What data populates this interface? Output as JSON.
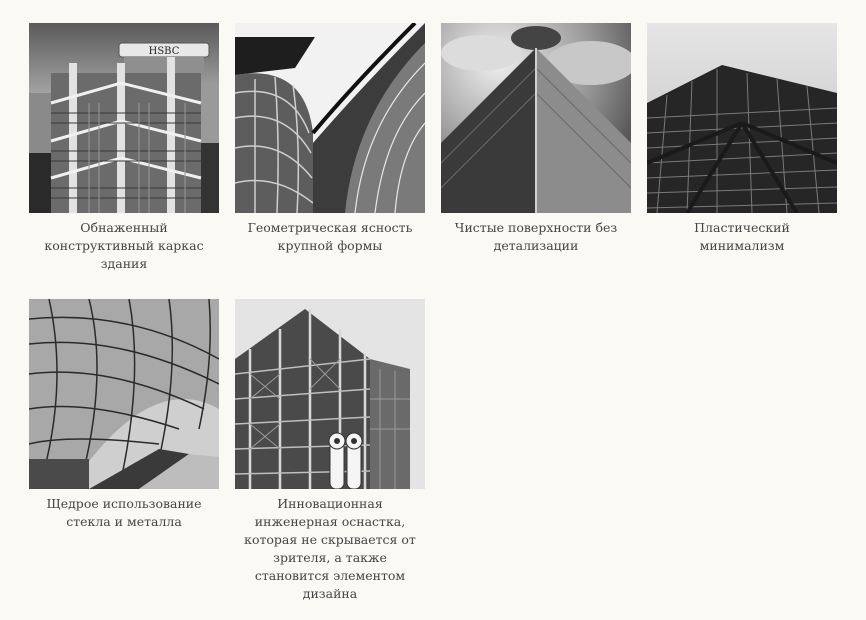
{
  "gallery": {
    "items": [
      {
        "caption": "Обнаженный конструктивный каркас здания",
        "image": "hsbc-building-photo"
      },
      {
        "caption": "Геометрическая ясность крупной формы",
        "image": "curved-glass-facade-photo"
      },
      {
        "caption": "Чистые поверхности без детализации",
        "image": "skyscraper-corner-photo"
      },
      {
        "caption": "Пластический минимализм",
        "image": "tower-grid-facade-photo"
      },
      {
        "caption": "Щедрое использование стекла и металла",
        "image": "glass-canopy-station-photo"
      },
      {
        "caption": "Инновационная инженерная оснастка, которая не скрывается от зрителя, а также становится элементом дизайна",
        "image": "pompidou-centre-photo"
      }
    ],
    "sign_text": "HSBC"
  }
}
